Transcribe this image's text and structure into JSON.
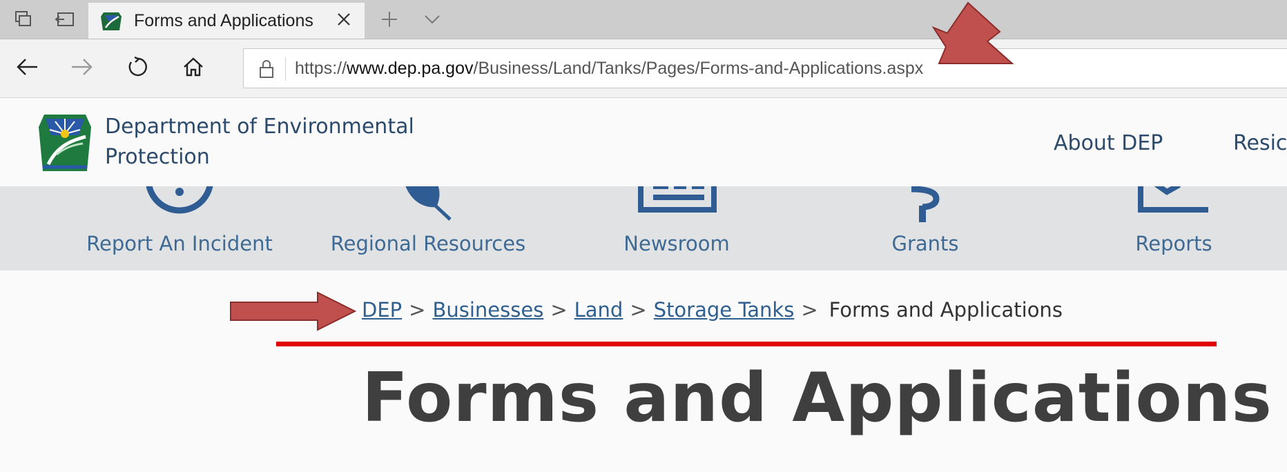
{
  "browser": {
    "tab": {
      "title": "Forms and Applications"
    },
    "address_bar": {
      "scheme": "https://",
      "host": "www.dep.pa.gov",
      "path": "/Business/Land/Tanks/Pages/Forms-and-Applications.aspx"
    },
    "icons": {
      "tab_switcher": "tab-switcher-icon",
      "set_aside": "set-aside-tabs-icon",
      "close": "close-icon",
      "new_tab": "plus-icon",
      "tab_list": "chevron-down-icon",
      "back": "back-arrow-icon",
      "forward": "forward-arrow-icon",
      "refresh": "refresh-icon",
      "home": "home-icon",
      "lock": "lock-icon"
    }
  },
  "site": {
    "name_line1": "Department of Environmental",
    "name_line2": "Protection",
    "nav": [
      "About DEP",
      "Resic"
    ],
    "quick_links": [
      {
        "label": "Report An Incident",
        "icon": "alert-circle-icon"
      },
      {
        "label": "Regional Resources",
        "icon": "leaf-icon"
      },
      {
        "label": "Newsroom",
        "icon": "newspaper-icon"
      },
      {
        "label": "Grants",
        "icon": "dollar-icon"
      },
      {
        "label": "Reports",
        "icon": "chart-icon"
      }
    ],
    "colors": {
      "brand_text": "#2c4a6b",
      "link": "#2e5f8f",
      "quick_link": "#3e6a94",
      "annotation_red": "#c0504d",
      "underline_red": "#e10000"
    }
  },
  "breadcrumb": {
    "items": [
      "DEP",
      "Businesses",
      "Land",
      "Storage Tanks"
    ],
    "separator": ">",
    "current": "Forms and Applications"
  },
  "page": {
    "title": "Forms and Applications"
  }
}
